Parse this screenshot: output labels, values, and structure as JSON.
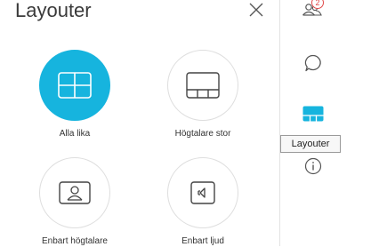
{
  "panel": {
    "title": "Layouter",
    "options": [
      {
        "id": "all-equal",
        "label": "Alla lika",
        "selected": true,
        "icon": "grid-layout-icon"
      },
      {
        "id": "speaker-large",
        "label": "Högtalare stor",
        "selected": false,
        "icon": "speaker-large-layout-icon"
      },
      {
        "id": "speaker-only",
        "label": "Enbart högtalare",
        "selected": false,
        "icon": "speaker-only-icon"
      },
      {
        "id": "audio-only",
        "label": "Enbart ljud",
        "selected": false,
        "icon": "audio-only-icon"
      }
    ]
  },
  "sidebar": {
    "participants_badge": "2",
    "tooltip": "Layouter",
    "icons": [
      "participants-icon",
      "chat-icon",
      "layout-icon",
      "info-icon"
    ]
  },
  "colors": {
    "accent": "#16b4de",
    "badge": "#e14a4a",
    "divider": "#e2e2e2"
  }
}
